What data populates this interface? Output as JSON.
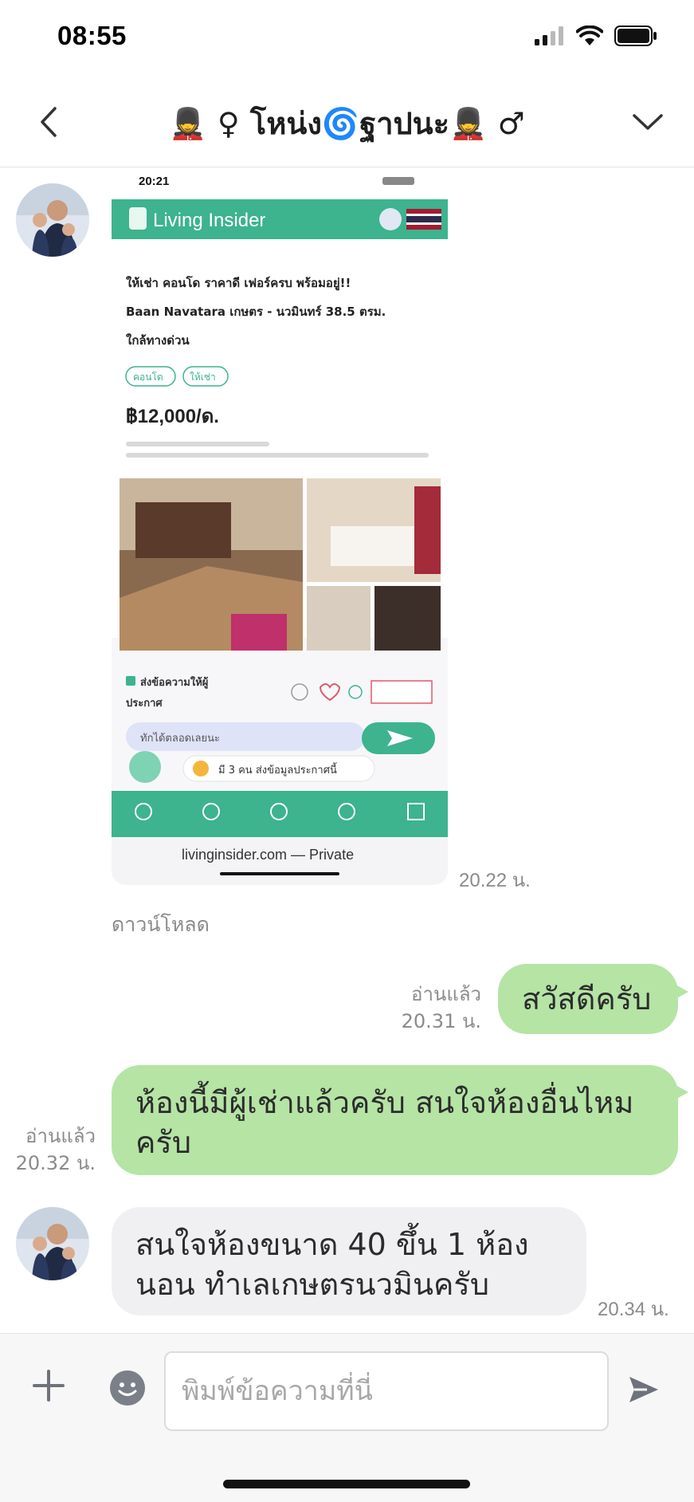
{
  "status_bar": {
    "time": "08:55"
  },
  "header": {
    "title": "💂 ♀ โหน่ง🌀ฐาปนะ💂 ♂"
  },
  "shared_image": {
    "time": "20.22 น.",
    "download_label": "ดาวน์โหลด",
    "screenshot": {
      "status_time": "20:21",
      "site_name": "Living Insider",
      "listing_title": "ให้เช่า คอนโด ราคาดี เฟอร์ครบ พร้อมอยู่!! Baan Navatara เกษตร - นวมินทร์ 38.5 ตรม. ใกล้ทางด่วน",
      "tags": [
        "คอนโด",
        "ให้เช่า"
      ],
      "price": "฿12,000/ด.",
      "contact_label": "ส่งข้อความให้ผู้ประกาศ",
      "fire_note": "มี 3 คน ส่งข้อมูลประกาศนี้",
      "url_bar": "livinginsider.com — Private"
    }
  },
  "messages": [
    {
      "text": "สวัสดีครับ",
      "read": "อ่านแล้ว",
      "time": "20.31 น."
    },
    {
      "line1": "ห้องนี้มีผู้เช่าแล้วครับ สนใจห้องอื่นไหม",
      "line2": "ครับ",
      "read": "อ่านแล้ว",
      "time": "20.32 น."
    },
    {
      "line1": "สนใจห้องขนาด 40 ขึ้น 1 ห้อง",
      "line2": "นอน ทำเลเกษตรนวมินครับ",
      "time": "20.34 น."
    }
  ],
  "input": {
    "placeholder": "พิมพ์ข้อความที่นี่"
  },
  "colors": {
    "outgoing_bubble": "#b5e4a5",
    "incoming_bubble": "#f0f0f2",
    "site_teal": "#3db38e"
  }
}
